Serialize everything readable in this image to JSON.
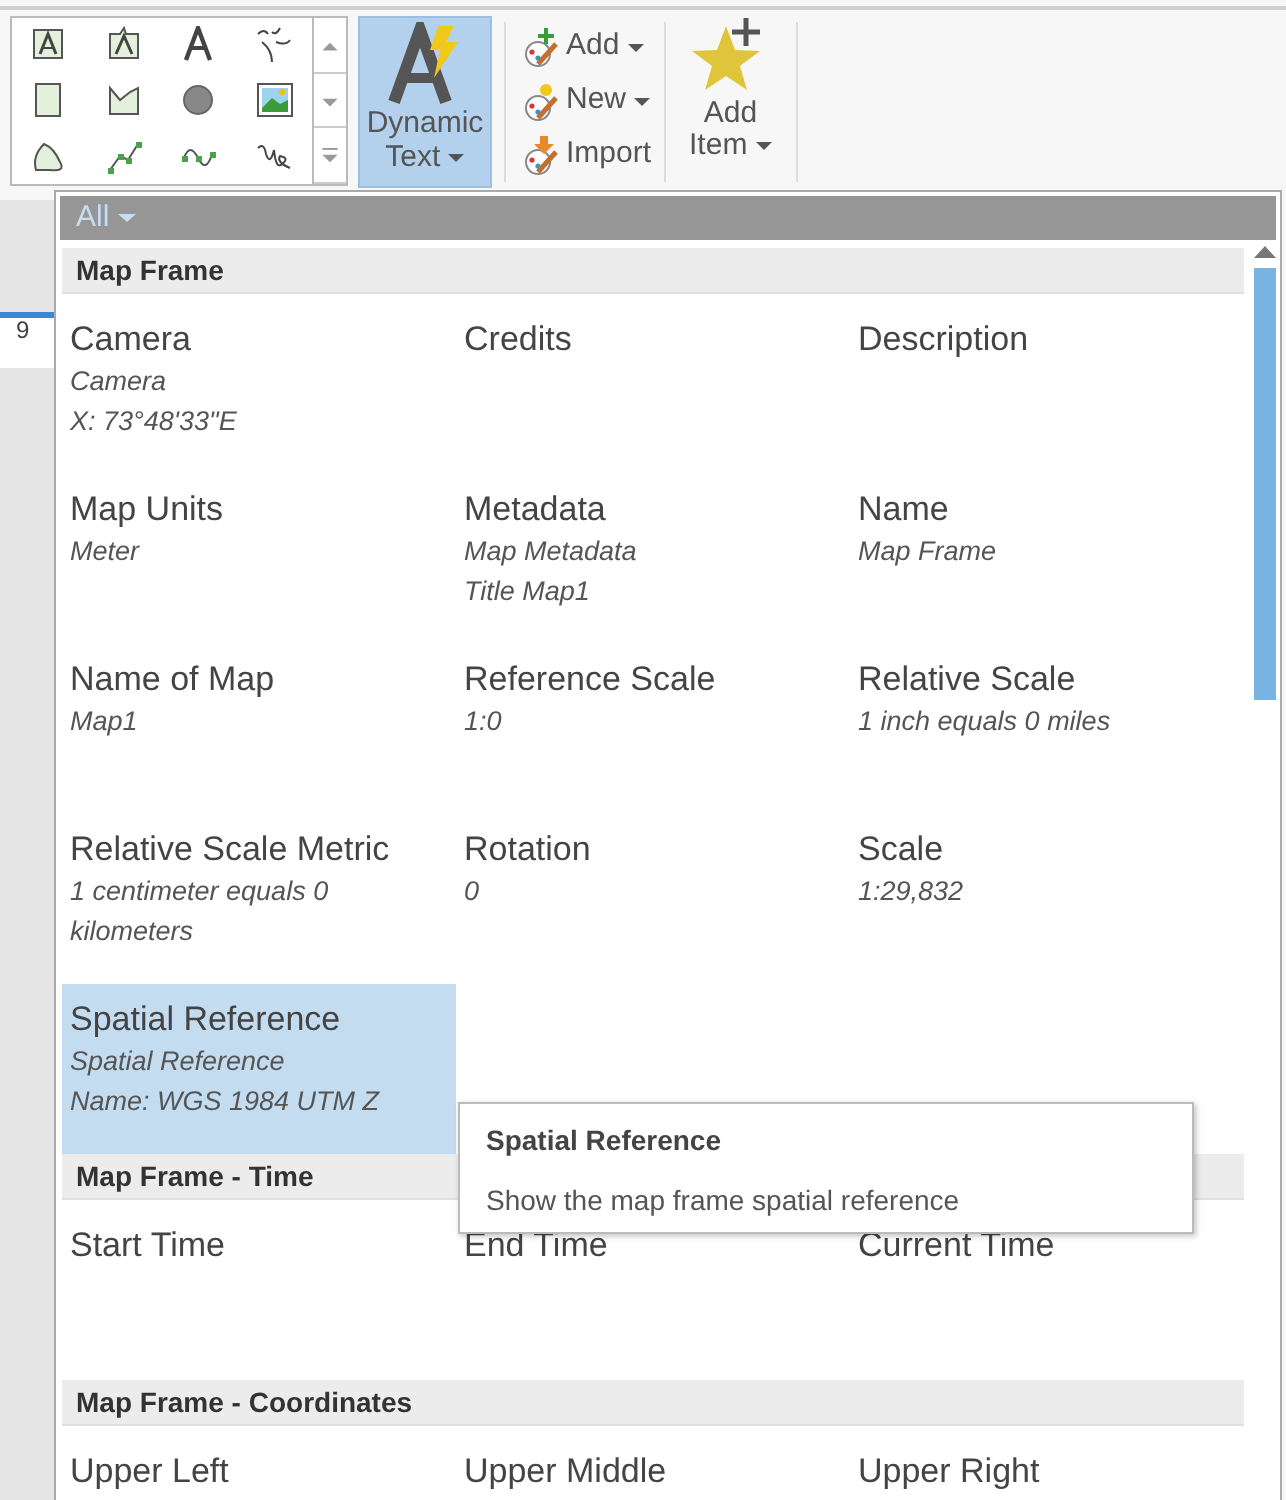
{
  "ribbon": {
    "dynamic_text": {
      "lines": [
        "Dynamic",
        "Text"
      ],
      "selected": true
    },
    "insert_buttons": [
      {
        "label": "Add",
        "menu": true
      },
      {
        "label": "New",
        "menu": true
      },
      {
        "label": "Import",
        "menu": false
      }
    ],
    "add_item": {
      "lines": [
        "Add",
        "Item"
      ]
    }
  },
  "ruler": {
    "label": "9"
  },
  "dynamic_text_menu": {
    "filter": "All",
    "sections": [
      {
        "title": "Map Frame",
        "items": [
          {
            "name": "Camera",
            "details": [
              "Camera",
              "X: 73°48'33\"E"
            ],
            "selected": false
          },
          {
            "name": "Credits",
            "selected": false
          },
          {
            "name": "Description",
            "selected": false
          },
          {
            "name": "Map Units",
            "details": [
              "Meter"
            ],
            "selected": false
          },
          {
            "name": "Metadata",
            "details": [
              "Map Metadata",
              "Title Map1"
            ],
            "selected": false
          },
          {
            "name": "Name",
            "details": [
              "Map Frame"
            ],
            "selected": false
          },
          {
            "name": "Name of Map",
            "details": [
              "Map1"
            ],
            "selected": false
          },
          {
            "name": "Reference Scale",
            "details": [
              "1:0"
            ],
            "selected": false
          },
          {
            "name": "Relative Scale",
            "details": [
              "1 inch equals 0 miles"
            ],
            "selected": false
          },
          {
            "name": "Relative Scale Metric",
            "details": [
              "1 centimeter equals 0 kilometers"
            ],
            "selected": false
          },
          {
            "name": "Rotation",
            "details": [
              "0"
            ],
            "selected": false
          },
          {
            "name": "Scale",
            "details": [
              "1:29,832"
            ],
            "selected": false
          },
          {
            "name": "Spatial Reference",
            "details": [
              "Spatial Reference",
              "Name: WGS 1984 UTM Z"
            ],
            "selected": true
          }
        ]
      },
      {
        "title": "Map Frame - Time",
        "items": [
          {
            "name": "Start Time",
            "selected": false
          },
          {
            "name": "End Time",
            "selected": false
          },
          {
            "name": "Current Time",
            "selected": false
          }
        ]
      },
      {
        "title": "Map Frame - Coordinates",
        "items": [
          {
            "name": "Upper Left",
            "selected": false
          },
          {
            "name": "Upper Middle",
            "selected": false
          },
          {
            "name": "Upper Right",
            "selected": false
          }
        ]
      }
    ],
    "tooltip": {
      "title": "Spatial Reference",
      "description": "Show the map frame spatial reference"
    }
  }
}
